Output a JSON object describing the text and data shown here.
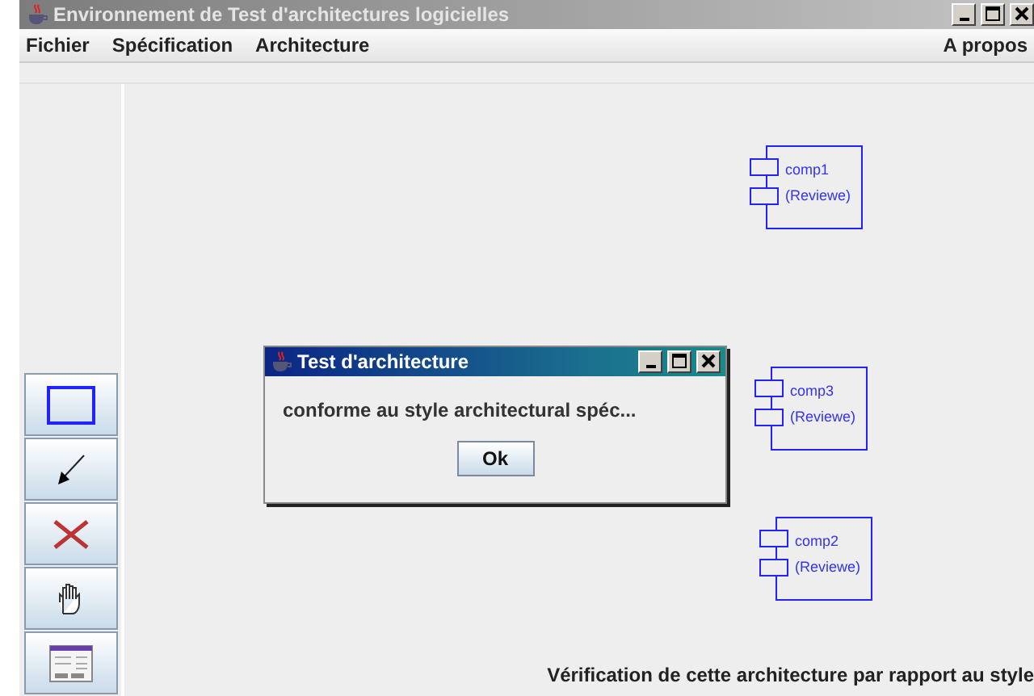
{
  "window": {
    "title": "Environnement de Test d'architectures logicielles"
  },
  "menu": {
    "items": [
      "Fichier",
      "Spécification",
      "Architecture"
    ],
    "right_item": "A propos"
  },
  "components": [
    {
      "name": "comp1",
      "label": "(Reviewe)"
    },
    {
      "name": "comp3",
      "label": "(Reviewe)"
    },
    {
      "name": "comp2",
      "label": "(Reviewe)"
    }
  ],
  "dialog": {
    "title": "Test d'architecture",
    "message": "conforme au style architectural spéc...",
    "button": "Ok"
  },
  "status": "Vérification de cette architecture par rapport au style"
}
